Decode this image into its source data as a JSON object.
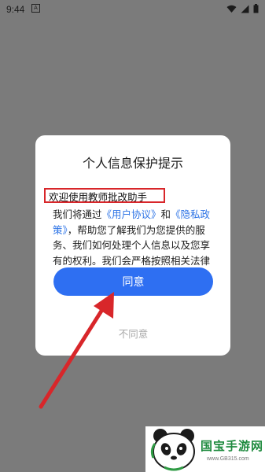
{
  "status_bar": {
    "time": "9:44",
    "notification_glyph": "A",
    "icons": [
      "wifi-icon",
      "signal-icon",
      "battery-icon"
    ]
  },
  "dialog": {
    "title": "个人信息保护提示",
    "welcome": "欢迎使用教师批改助手",
    "body": {
      "p1": "我们将通过",
      "link_user_agreement": "《用户协议》",
      "p2": "和",
      "link_privacy": "《隐私政策》",
      "p3": "，帮助您了解我们为您提供的服务、我们如何处理个人信息以及您享有的权利。我们会严格按照相关法律法规要求，采取各种安全"
    },
    "agree_label": "同意",
    "disagree_label": "不同意"
  },
  "watermark": {
    "title": "国宝手游网",
    "url": "www.GB315.com"
  },
  "colors": {
    "overlay": "#7b7b7b",
    "primary": "#2e6ff2",
    "link": "#2e74e6",
    "annotation": "#d8262a",
    "watermark_green": "#1e8a3e"
  }
}
